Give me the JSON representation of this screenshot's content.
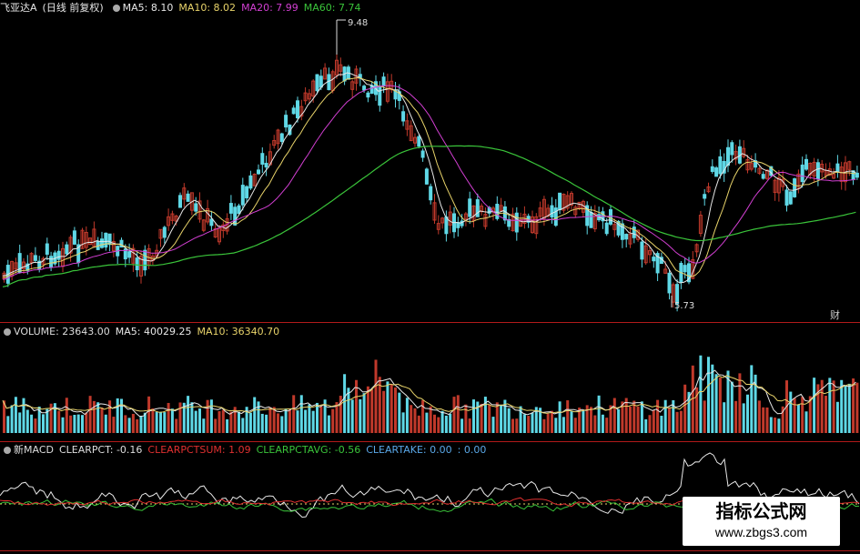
{
  "price_panel": {
    "title": "飞亚达A",
    "subtitle": "(日线 前复权)",
    "indicators": [
      {
        "text": "MA5: 8.10",
        "color": "#e8e8e8"
      },
      {
        "text": "MA10: 8.02",
        "color": "#e8d36a"
      },
      {
        "text": "MA20: 7.99",
        "color": "#d23fd2"
      },
      {
        "text": "MA60: 7.74",
        "color": "#3ac43a"
      }
    ],
    "high_label": "9.48",
    "low_label": "5.73",
    "badge": "财"
  },
  "volume_panel": {
    "indicators": [
      {
        "text": "VOLUME: 23643.00",
        "color": "#dddddd"
      },
      {
        "text": "MA5: 40029.25",
        "color": "#e8e8e8"
      },
      {
        "text": "MA10: 36340.70",
        "color": "#e8d36a"
      }
    ]
  },
  "macd_panel": {
    "indicators": [
      {
        "text": "新MACD",
        "color": "#dddddd"
      },
      {
        "text": "CLEARPCT: -0.16",
        "color": "#dddddd"
      },
      {
        "text": "CLEARPCTSUM: 1.09",
        "color": "#e03030"
      },
      {
        "text": "CLEARPCTAVG: -0.56",
        "color": "#3ac43a"
      },
      {
        "text": "CLEARTAKE: 0.00",
        "color": "#5aa8e8"
      },
      {
        "text": ": 0.00",
        "color": "#5aa8e8"
      }
    ]
  },
  "watermark": {
    "title": "指标公式网",
    "url": "www.zbgs3.com"
  },
  "colors": {
    "up": "#c0392b",
    "down": "#5fd8e6",
    "ma5": "#e8e8e8",
    "ma10": "#e8d36a",
    "ma20": "#d23fd2",
    "ma60": "#3ac43a",
    "divider": "#b21a1a"
  }
}
